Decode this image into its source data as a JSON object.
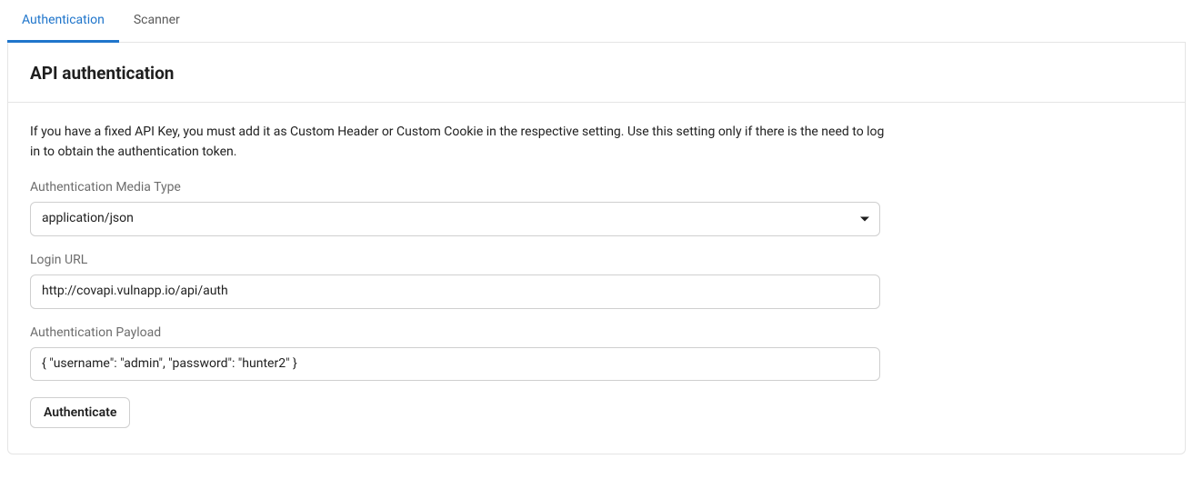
{
  "tabs": {
    "authentication": "Authentication",
    "scanner": "Scanner"
  },
  "panel": {
    "title": "API authentication",
    "description": "If you have a fixed API Key, you must add it as Custom Header or Custom Cookie in the respective setting. Use this setting only if there is the need to log in to obtain the authentication token."
  },
  "fields": {
    "media_type": {
      "label": "Authentication Media Type",
      "value": "application/json"
    },
    "login_url": {
      "label": "Login URL",
      "value": "http://covapi.vulnapp.io/api/auth"
    },
    "payload": {
      "label": "Authentication Payload",
      "value": "{ \"username\": \"admin\", \"password\": \"hunter2\" }"
    }
  },
  "buttons": {
    "authenticate": "Authenticate"
  }
}
